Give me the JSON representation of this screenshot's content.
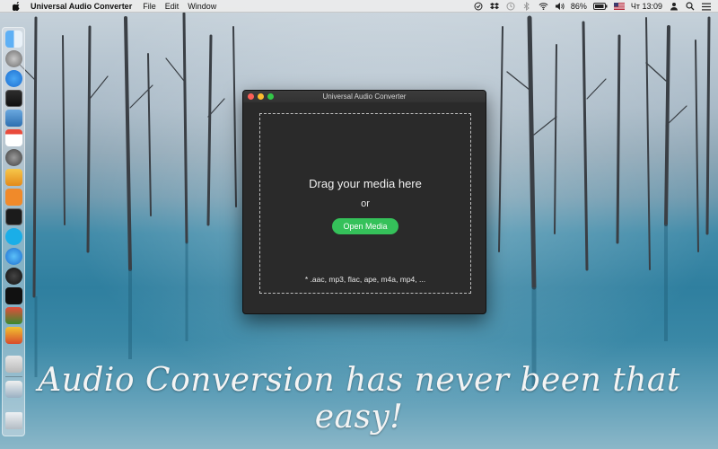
{
  "menubar": {
    "app_name": "Universal Audio Converter",
    "menus": [
      "File",
      "Edit",
      "Window"
    ],
    "battery": "86%",
    "clock": "Чт 13:09"
  },
  "window": {
    "title": "Universal Audio Converter",
    "drop_title": "Drag your media here",
    "or_label": "or",
    "open_button": "Open Media",
    "formats": "* .aac, mp3, flac, ape, m4a, mp4, ..."
  },
  "tagline": "Audio Conversion has never been that easy!",
  "dock": {
    "icons": [
      "finder-icon",
      "launchpad-icon",
      "app-store-icon",
      "mission-control-icon",
      "preview-icon",
      "calendar-icon",
      "system-preferences-icon",
      "ibooks-icon",
      "terminal-icon",
      "skype-icon",
      "safari-icon",
      "itunes-icon",
      "bbc-icon",
      "app-icon",
      "app-icon",
      "file-icon",
      "file-icon",
      "trash-icon"
    ]
  },
  "colors": {
    "accent_green": "#35c15a",
    "window_bg": "#2a2a2a",
    "close": "#fc5f57",
    "minimize": "#fdbc2e",
    "maximize": "#33c748"
  }
}
